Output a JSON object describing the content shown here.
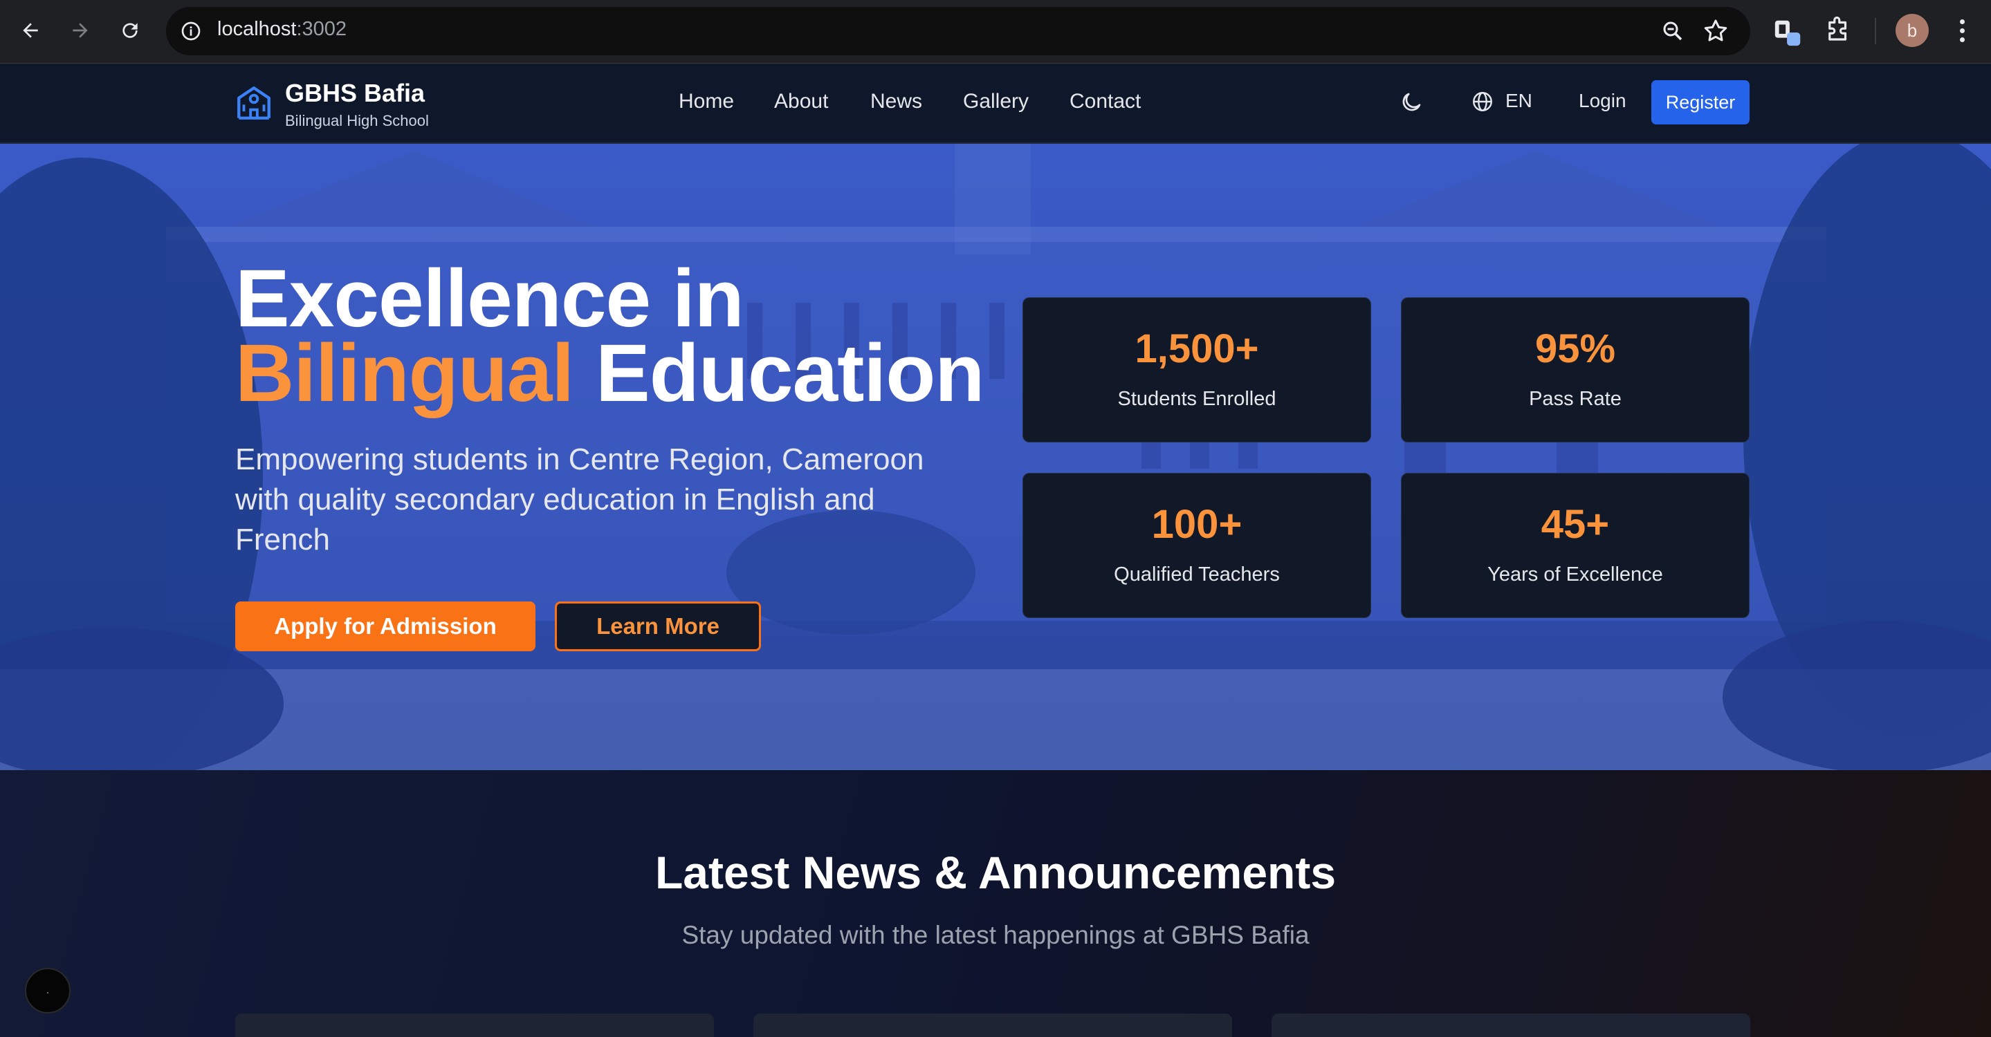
{
  "browser": {
    "url_host": "localhost",
    "url_port": ":3002",
    "profile_initial": "b"
  },
  "site": {
    "brand_title": "GBHS Bafia",
    "brand_subtitle": "Bilingual High School",
    "nav": [
      "Home",
      "About",
      "News",
      "Gallery",
      "Contact"
    ],
    "language": "EN",
    "login_label": "Login",
    "register_label": "Register"
  },
  "hero": {
    "title_line1": "Excellence in",
    "title_accent": "Bilingual",
    "title_rest": " Education",
    "subtitle": "Empowering students in Centre Region, Cameroon with quality secondary education in English and French",
    "apply_label": "Apply for Admission",
    "learn_label": "Learn More",
    "stats": [
      {
        "value": "1,500+",
        "label": "Students Enrolled"
      },
      {
        "value": "95%",
        "label": "Pass Rate"
      },
      {
        "value": "100+",
        "label": "Qualified Teachers"
      },
      {
        "value": "45+",
        "label": "Years of Excellence"
      }
    ]
  },
  "news": {
    "title": "Latest News & Announcements",
    "subtitle": "Stay updated with the latest happenings at GBHS Bafia"
  },
  "widget": {
    "label": "."
  },
  "colors": {
    "accent_orange": "#f97316",
    "brand_blue": "#2563eb",
    "nav_bg": "#0f172a",
    "card_bg": "#111827"
  }
}
